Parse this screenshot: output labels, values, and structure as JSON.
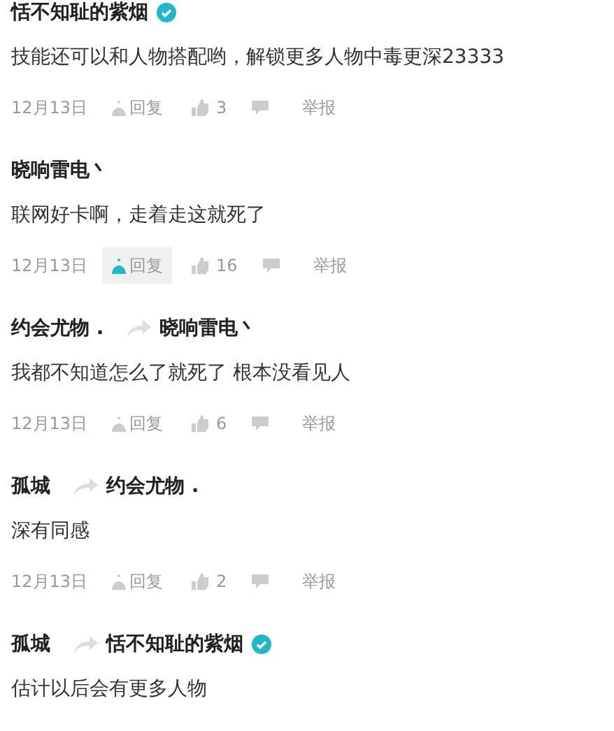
{
  "comments": [
    {
      "author": {
        "name": "恬不知耻的紫烟",
        "verified": true
      },
      "text": "技能还可以和人物搭配哟，解锁更多人物中毒更深23333",
      "meta": {
        "date": "12月13日",
        "reply": "回复",
        "reply_hovered": false,
        "likes": "3",
        "report": "举报"
      }
    },
    {
      "author": {
        "name": "晓响雷电丶",
        "verified": false
      },
      "text": "联网好卡啊，走着走这就死了",
      "meta": {
        "date": "12月13日",
        "reply": "回复",
        "reply_hovered": true,
        "likes": "16",
        "report": "举报"
      }
    },
    {
      "author": {
        "name": "约会尤物 .",
        "verified": false
      },
      "reply_to": {
        "name": "晓响雷电丶",
        "verified": false
      },
      "text": "我都不知道怎么了就死了 根本没看见人",
      "meta": {
        "date": "12月13日",
        "reply": "回复",
        "reply_hovered": false,
        "likes": "6",
        "report": "举报"
      }
    },
    {
      "author": {
        "name": "孤城",
        "verified": false
      },
      "reply_to": {
        "name": "约会尤物 .",
        "verified": false
      },
      "text": "深有同感",
      "meta": {
        "date": "12月13日",
        "reply": "回复",
        "reply_hovered": false,
        "likes": "2",
        "report": "举报"
      }
    },
    {
      "author": {
        "name": "孤城",
        "verified": false
      },
      "reply_to": {
        "name": "恬不知耻的紫烟",
        "verified": true
      },
      "text": "估计以后会有更多人物"
    }
  ]
}
